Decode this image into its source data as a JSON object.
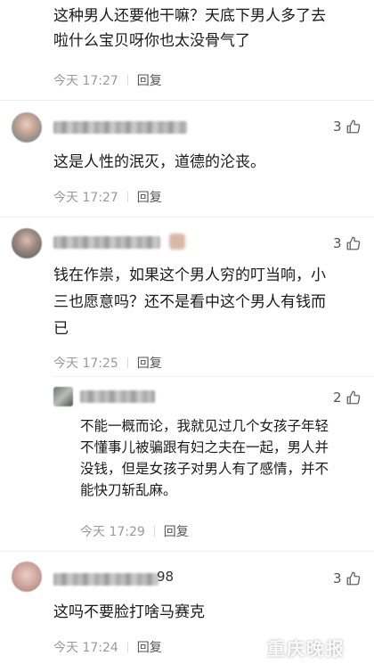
{
  "comments": [
    {
      "text": "这种男人还要他干嘛？天底下男人多了去\n啦什么宝贝呀你也太没骨气了",
      "time": "今天 17:27",
      "reply_label": "回复"
    },
    {
      "likes": "3",
      "text": "这是人性的泯灭，道德的沦丧。",
      "time": "今天 17:27",
      "reply_label": "回复"
    },
    {
      "likes": "3",
      "text": "钱在作祟，如果这个男人穷的叮当响，小\n三也愿意吗？还不是看中这个男人有钱而\n已",
      "time": "今天 17:25",
      "reply_label": "回复"
    },
    {
      "likes": "2",
      "text": "不能一概而论，我就见过几个女孩子年轻\n不懂事儿被骗跟有妇之夫在一起，男人并\n没钱，但是女孩子对男人有了感情，并不\n能快刀斩乱麻。",
      "time": "今天 17:29",
      "reply_label": "回复"
    },
    {
      "username_suffix": "98",
      "likes": "3",
      "text": "这吗不要脸打啥马赛克",
      "time": "今天 17:24",
      "reply_label": "回复"
    }
  ],
  "watermark": "重庆晚报"
}
